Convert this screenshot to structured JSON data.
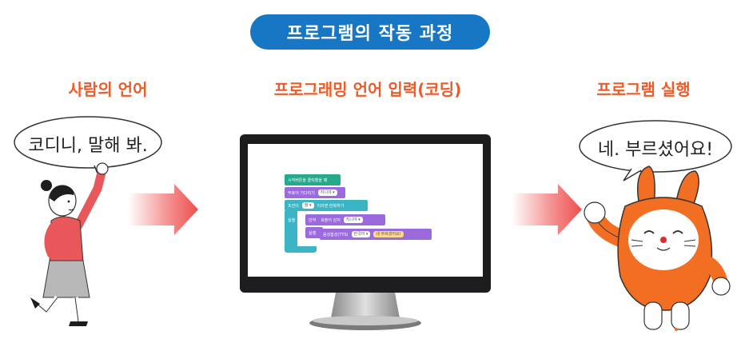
{
  "title": "프로그램의 작동 과정",
  "columns": [
    {
      "label": "사람의 언어",
      "speech": "코디니, 말해 봐."
    },
    {
      "label": "프로그래밍 언어 입력(코딩)"
    },
    {
      "label": "프로그램 실행",
      "speech": "네. 부르셨어요!"
    }
  ],
  "code_blocks": {
    "start": "시작버튼을 클릭했을 때",
    "wait": "부호어 기다리기",
    "wait_chip": "지니야 ▾",
    "condition": "조건이",
    "cond_chip": "참 ▾",
    "repeat_text": "이라면 반복하기",
    "run": "실행",
    "if_label": "만약",
    "if_text": "호출어 감지",
    "if_chip": "지니야 ▾",
    "run2": "실행",
    "speak": "음성합성(TTS)",
    "lang_chip": "한국어 ▾",
    "speak_text": "네 부르셨어요!"
  },
  "colors": {
    "title_bg": "#1777c4",
    "label_orange": "#ee5a28",
    "arrow": "#ee4e4e",
    "block_green": "#27a98b",
    "block_purple": "#9b6bde",
    "block_teal": "#3bb5c4",
    "character_orange": "#f26e22"
  }
}
